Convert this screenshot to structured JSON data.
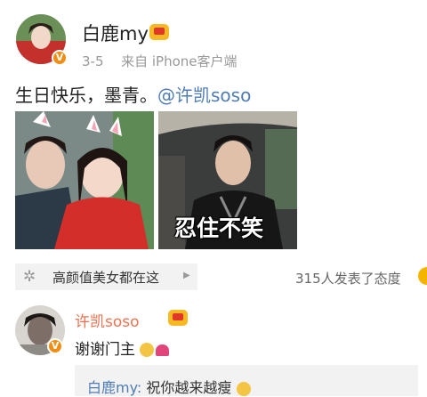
{
  "post": {
    "username": "白鹿my",
    "timestamp": "3-5",
    "source_prefix": "来自",
    "source_device": "iPhone客户端",
    "text": "生日快乐，墨青。",
    "mention": "@许凯soso",
    "image2_caption": "忍住不笑"
  },
  "tag": {
    "text": "高颜值美女都在这",
    "reactions": "315人发表了态度"
  },
  "reply": {
    "username": "许凯soso",
    "text": "谢谢门主",
    "quote_user": "白鹿my:",
    "quote_text": "祝你越来越瘦"
  },
  "icons": {
    "verified": "verified-v-icon",
    "vip": "vip-crown-icon",
    "tag": "sparkle-icon",
    "arrow": "chevron-right-icon",
    "reaction": "emoji-icon"
  },
  "colors": {
    "mention": "#4f7cb7",
    "reply_name": "#eb7350",
    "verified": "#f28d14",
    "crown": "#f6b823"
  }
}
